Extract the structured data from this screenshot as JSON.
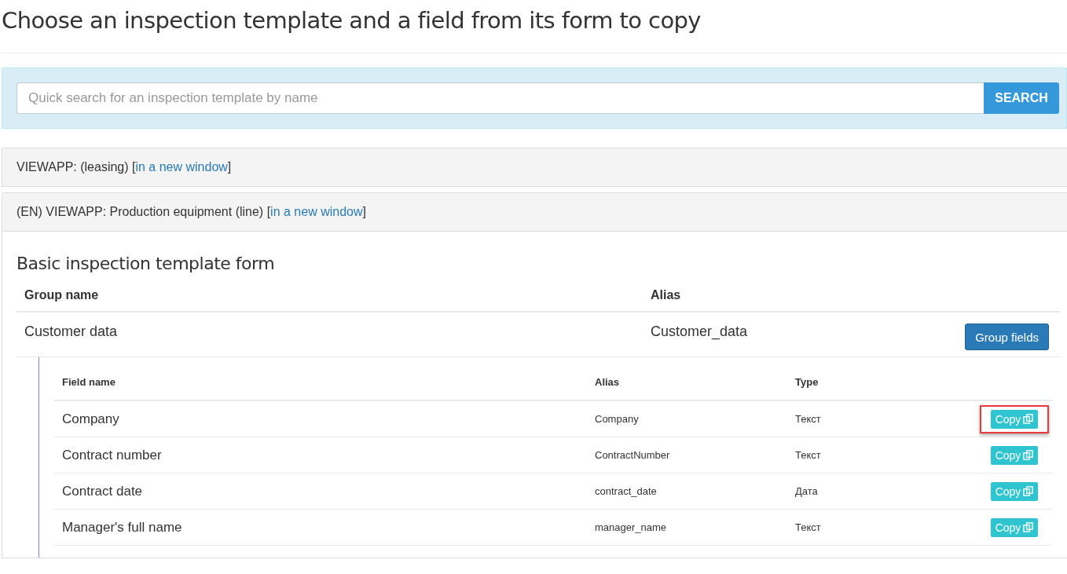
{
  "title": "Choose an inspection template and a field from its form to copy",
  "search": {
    "placeholder": "Quick search for an inspection template by name",
    "button": "SEARCH"
  },
  "templates": [
    {
      "name": "VIEWAPP: (leasing) [",
      "link": "in a new window",
      "suffix": "]",
      "expanded": false
    },
    {
      "name": "(EN) VIEWAPP: Production equipment (line) [",
      "link": "in a new window",
      "suffix": "]",
      "expanded": true,
      "form": {
        "heading": "Basic inspection template form",
        "group_columns": [
          "Group name",
          "Alias"
        ],
        "groups": [
          {
            "name": "Customer data",
            "alias": "Customer_data",
            "button": "Group fields",
            "field_columns": [
              "Field name",
              "Alias",
              "Type"
            ],
            "fields": [
              {
                "name": "Company",
                "alias": "Company",
                "type": "Текст",
                "button": "Copy",
                "highlighted": true
              },
              {
                "name": "Contract number",
                "alias": "ContractNumber",
                "type": "Текст",
                "button": "Copy",
                "highlighted": false
              },
              {
                "name": "Contract date",
                "alias": "contract_date",
                "type": "Дата",
                "button": "Copy",
                "highlighted": false
              },
              {
                "name": "Manager's full name",
                "alias": "manager_name",
                "type": "Текст",
                "button": "Copy",
                "highlighted": false
              }
            ]
          }
        ]
      }
    }
  ]
}
